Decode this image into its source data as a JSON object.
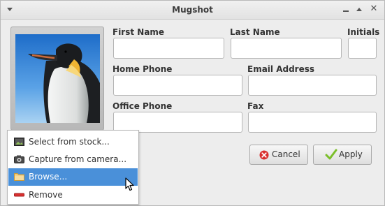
{
  "window": {
    "title": "Mugshot"
  },
  "form": {
    "first_name": {
      "label": "First Name",
      "value": ""
    },
    "last_name": {
      "label": "Last Name",
      "value": ""
    },
    "initials": {
      "label": "Initials",
      "value": ""
    },
    "home_phone": {
      "label": "Home Phone",
      "value": ""
    },
    "email": {
      "label": "Email Address",
      "value": ""
    },
    "office_phone": {
      "label": "Office Phone",
      "value": ""
    },
    "fax": {
      "label": "Fax",
      "value": ""
    }
  },
  "buttons": {
    "cancel": "Cancel",
    "apply": "Apply"
  },
  "photo_menu": {
    "items": [
      {
        "label": "Select from stock...",
        "icon": "image-icon"
      },
      {
        "label": "Capture from camera...",
        "icon": "camera-icon"
      },
      {
        "label": "Browse...",
        "icon": "folder-icon",
        "highlighted": true
      },
      {
        "label": "Remove",
        "icon": "remove-icon"
      }
    ]
  },
  "colors": {
    "highlight": "#4a90d9",
    "window_bg": "#ededed",
    "cancel_icon": "#d9302f",
    "apply_icon": "#7bbf2a"
  }
}
